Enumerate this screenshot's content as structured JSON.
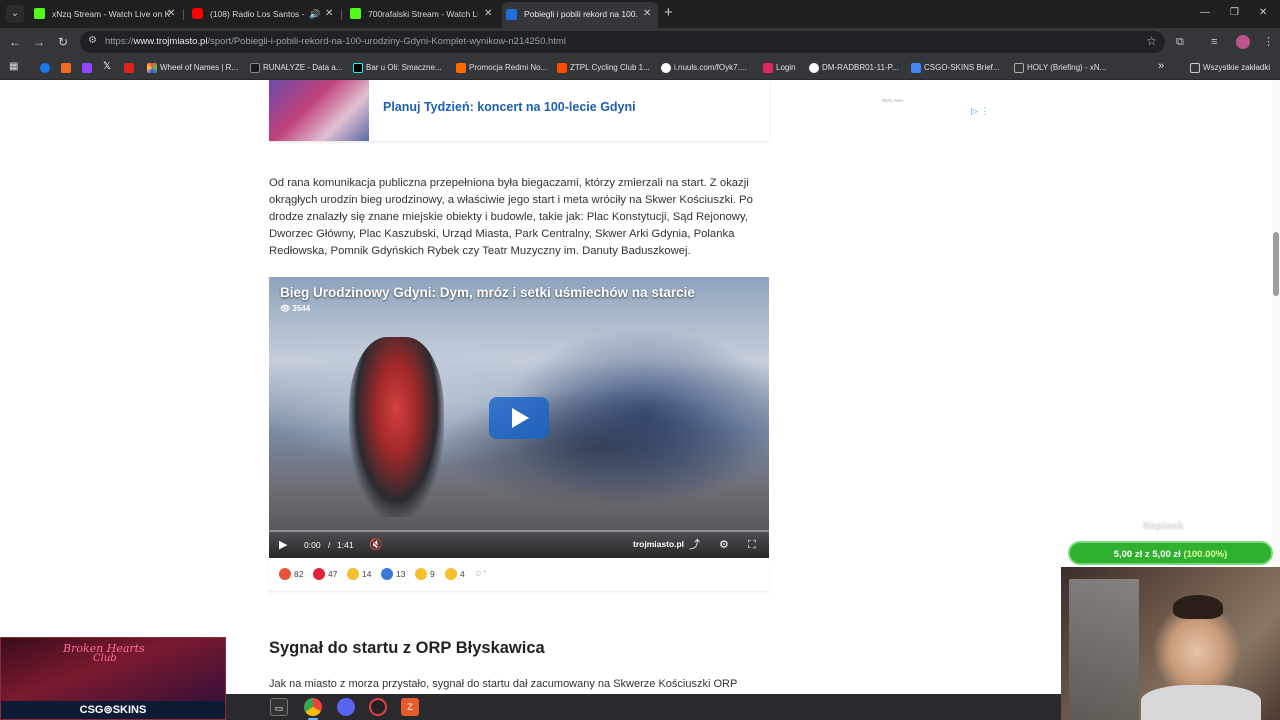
{
  "browser": {
    "tabs": [
      {
        "title": "xNzq Stream - Watch Live on K",
        "icon": "kick-icon"
      },
      {
        "title": "(108) Radio Los Santos - GT",
        "icon": "youtube-icon"
      },
      {
        "title": "700rafalski Stream - Watch Live",
        "icon": "kick-icon"
      },
      {
        "title": "Pobiegli i pobili rekord na 100.",
        "icon": "trojmiasto-icon"
      }
    ],
    "address": {
      "prefix": "https://",
      "domain": "www.trojmiasto.pl",
      "path": "/sport/Pobiegli-i-pobili-rekord-na-100-urodziny-Gdyni-Komplet-wynikow-n214250.html"
    },
    "bookmarks": [
      "Wheel of Names | R...",
      "RUNALYZE - Data a...",
      "Bar u Oli: Smaczne...",
      "Promocja Redmi No...",
      "ZTPL Cycling Club 1...",
      "i.nuuls.com/fOyk7....",
      "Login",
      "DM-RADBR01-11-P...",
      "CSGO-SKINS Brief...",
      "HOLY (Briefing) - xN..."
    ],
    "bookmarks_more": "Wszystkie zakładki"
  },
  "page": {
    "related_title": "Planuj Tydzień: koncert na 100-lecie Gdyni",
    "ad_label": "REKLAMA",
    "paragraph1": "Od rana komunikacja publiczna przepełniona była biegaczami, którzy zmierzali na start. Z okazji okrągłych urodzin bieg urodzinowy, a właściwie jego start i meta wróciły na Skwer Kościuszki. Po drodze znalazły się znane miejskie obiekty i budowle, takie jak: Plac Konstytucji, Sąd Rejonowy, Dworzec Główny, Plac Kaszubski, Urząd Miasta, Park Centralny, Skwer Arki Gdynia, Polanka Redłowska, Pomnik Gdyńskich Rybek czy Teatr Muzyczny im. Danuty Baduszkowej.",
    "video": {
      "title": "Bieg Urodzinowy Gdyni: Dym, mróz i setki uśmiechów na starcie",
      "views": "3544",
      "time_current": "0:00",
      "time_sep": "/",
      "time_total": "1:41",
      "brand": "trojmiasto.pl",
      "progress": 0
    },
    "reactions": [
      {
        "icon": "angry-reaction-icon",
        "count": "82",
        "color": "#e8543a",
        "glyph": "😡"
      },
      {
        "icon": "heart-reaction-icon",
        "count": "47",
        "color": "#e0243a",
        "glyph": "♥"
      },
      {
        "icon": "laugh-reaction-icon",
        "count": "14",
        "color": "#f5c02a",
        "glyph": "😆"
      },
      {
        "icon": "like-reaction-icon",
        "count": "13",
        "color": "#3a78d8",
        "glyph": "👍"
      },
      {
        "icon": "sad-reaction-icon",
        "count": "9",
        "color": "#f5c02a",
        "glyph": "😢"
      },
      {
        "icon": "wow-reaction-icon",
        "count": "4",
        "color": "#f5c02a",
        "glyph": "😮"
      }
    ],
    "heading2": "Sygnał do startu z ORP Błyskawica",
    "paragraph2": "Jak na miasto z morza przystało, sygnał do startu dał zacumowany na Skwerze Kościuszki ORP"
  },
  "stream": {
    "overlay_line1": "Broken Hearts",
    "overlay_line2": "Club",
    "brand": "CSG⊚SKINS",
    "donate_label": "Napiwek",
    "donate_amount": "5,00 zł",
    "donate_sep": "z",
    "donate_goal": "5,00 zł",
    "donate_pct": "(100.00%)",
    "donate_progress": 1.0
  },
  "colors": {
    "link": "#1d5fb0",
    "donate": "#2fb12f"
  }
}
